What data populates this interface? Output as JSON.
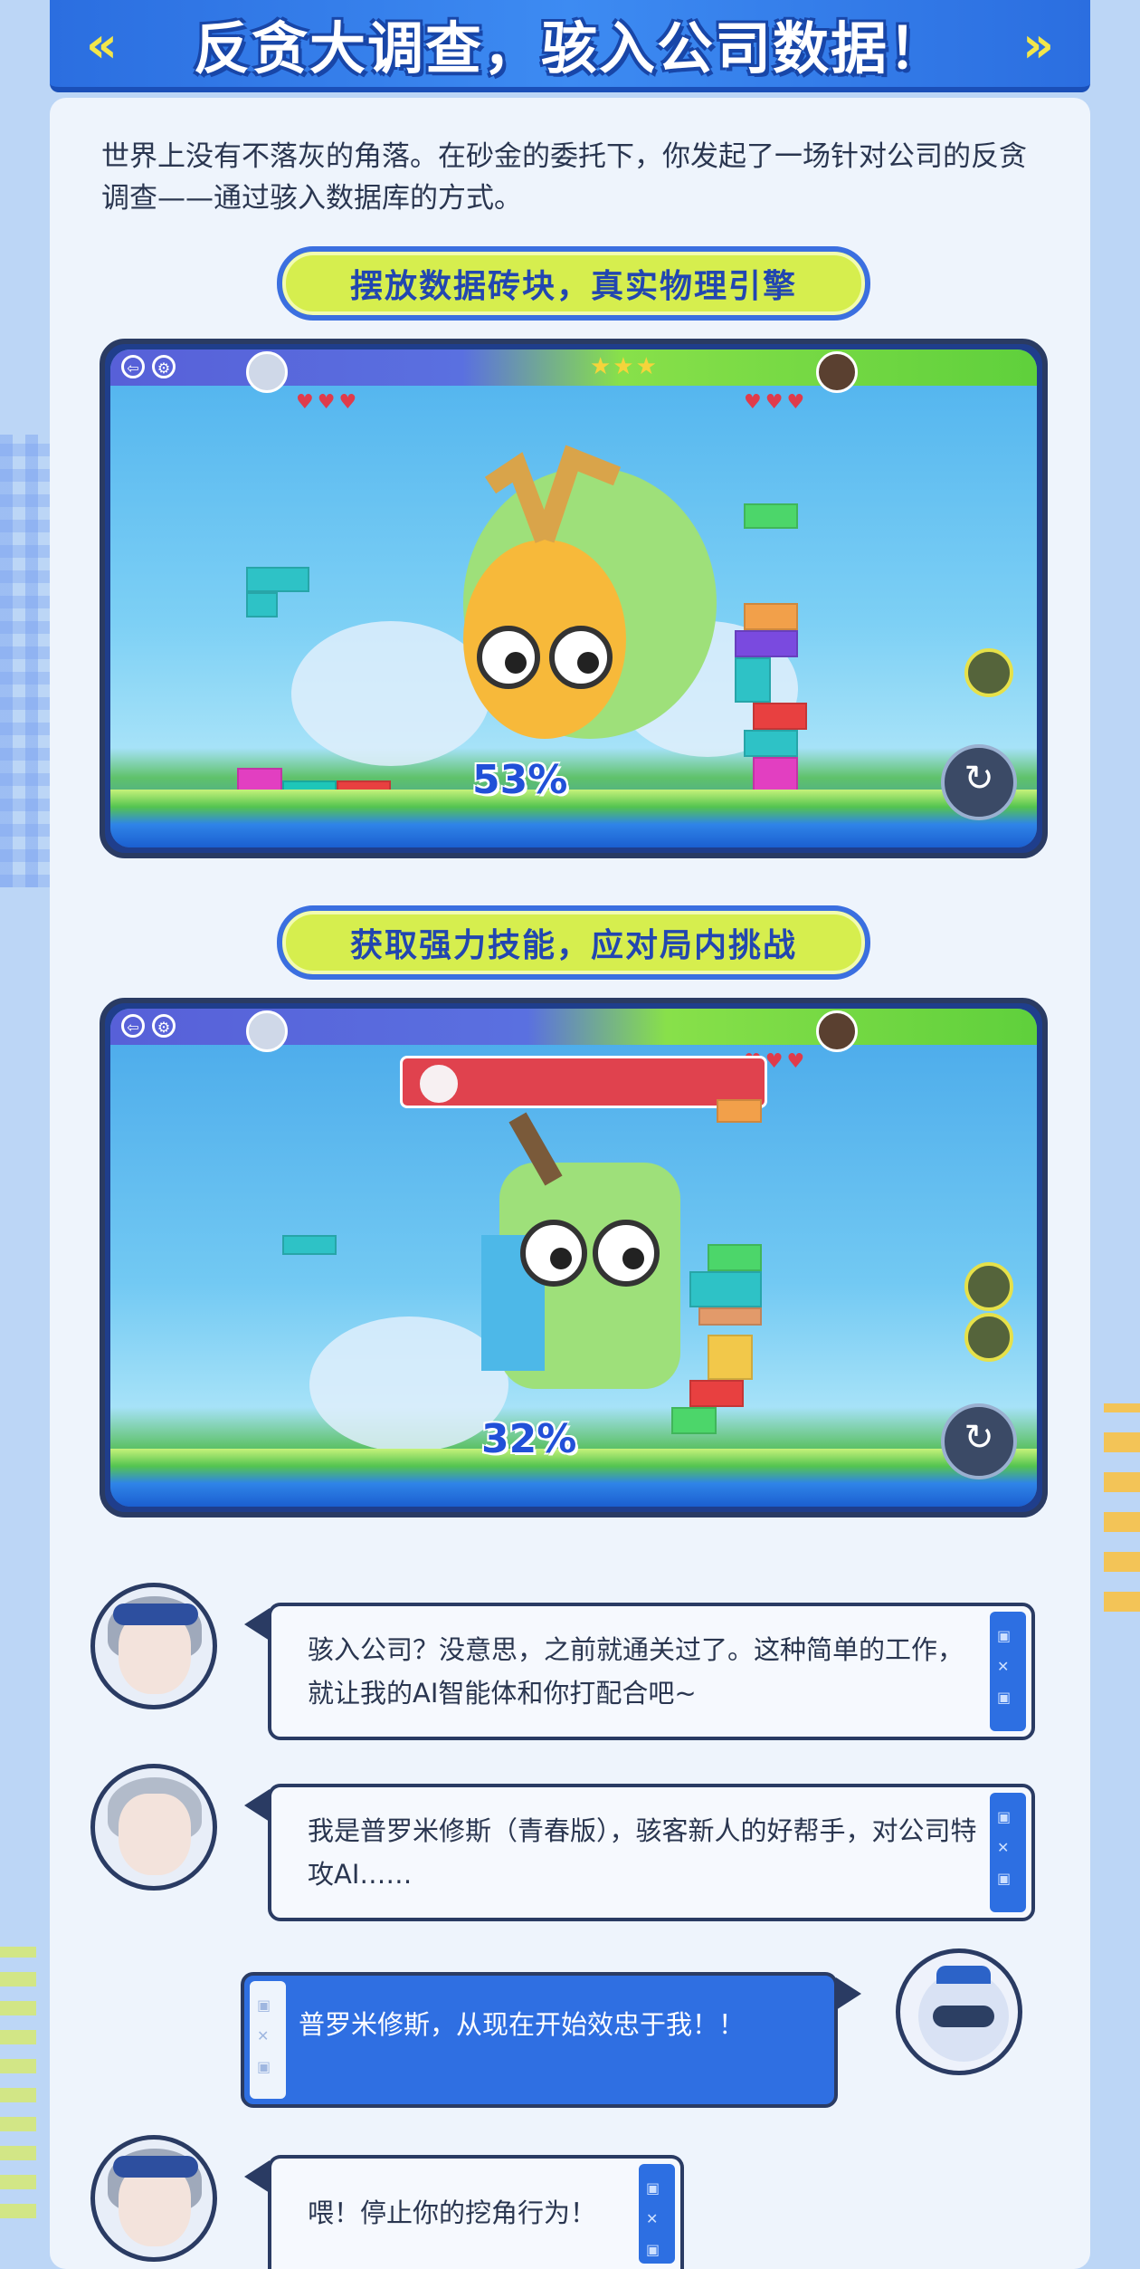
{
  "header": {
    "title": "反贪大调查，骇入公司数据！"
  },
  "intro": {
    "text": "世界上没有不落灰的角落。在砂金的委托下，你发起了一场针对公司的反贪调查——通过骇入数据库的方式。"
  },
  "sections": [
    {
      "pill": "摆放数据砖块，真实物理引擎",
      "progress_label": "53%",
      "progress_value": 53
    },
    {
      "pill": "获取强力技能，应对局内挑战",
      "progress_label": "32%",
      "progress_value": 32
    }
  ],
  "chat": [
    {
      "speaker": "silver-wolf",
      "side": "left",
      "text": "骇入公司？没意思，之前就通关过了。这种简单的工作，就让我的AI智能体和你打配合吧~"
    },
    {
      "speaker": "prometheus-ai",
      "side": "left",
      "text": "我是普罗米修斯（青春版），骇客新人的好帮手，对公司特攻AI……"
    },
    {
      "speaker": "raccoon",
      "side": "right",
      "text": "普罗米修斯，从现在开始效忠于我！！"
    },
    {
      "speaker": "silver-wolf",
      "side": "left",
      "text": "喂！停止你的挖角行为！"
    }
  ],
  "colors": {
    "accent_blue": "#2d6fe2",
    "pill_green": "#d6ee4e",
    "dark_outline": "#2a3b63"
  }
}
